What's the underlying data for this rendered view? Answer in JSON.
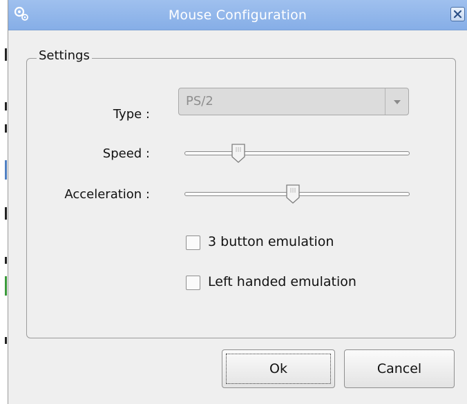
{
  "window": {
    "title": "Mouse Configuration",
    "icon": "gears-icon",
    "close_icon": "close-icon"
  },
  "settings": {
    "group_label": "Settings",
    "type": {
      "label": "Type :",
      "value": "PS/2",
      "disabled": true
    },
    "speed": {
      "label": "Speed :",
      "level": 0.22
    },
    "acceleration": {
      "label": "Acceleration :",
      "level": 0.48
    },
    "three_button_emulation": {
      "label": "3 button emulation",
      "checked": false
    },
    "left_handed_emulation": {
      "label": "Left handed emulation",
      "checked": false
    }
  },
  "buttons": {
    "ok_label": "Ok",
    "cancel_label": "Cancel"
  },
  "colors": {
    "titlebar": "#8fb4ea",
    "window_bg": "#efefef"
  }
}
